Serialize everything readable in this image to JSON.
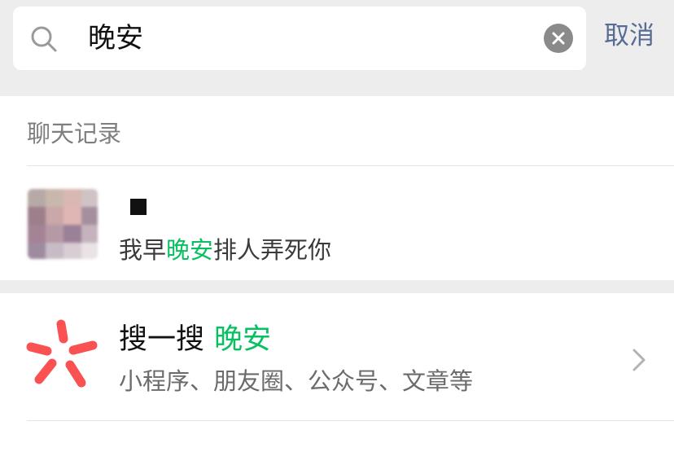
{
  "search": {
    "query": "晚安",
    "cancel_label": "取消"
  },
  "chat_history": {
    "section_title": "聊天记录",
    "result": {
      "snippet_pre": "我早",
      "snippet_hl": "晚安",
      "snippet_post": "排人弄死你"
    }
  },
  "souyisou": {
    "label": "搜一搜",
    "keyword": "晚安",
    "subtitle": "小程序、朋友圈、公众号、文章等"
  },
  "colors": {
    "accent_green": "#07c160",
    "link_blue": "#576b95",
    "souyisou_red": "#fa5151"
  }
}
